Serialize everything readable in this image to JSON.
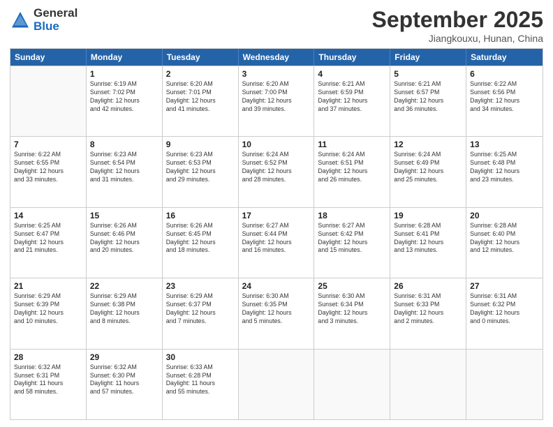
{
  "logo": {
    "general": "General",
    "blue": "Blue"
  },
  "header": {
    "month": "September 2025",
    "location": "Jiangkouxu, Hunan, China"
  },
  "days_of_week": [
    "Sunday",
    "Monday",
    "Tuesday",
    "Wednesday",
    "Thursday",
    "Friday",
    "Saturday"
  ],
  "weeks": [
    [
      {
        "day": "",
        "info": ""
      },
      {
        "day": "1",
        "info": "Sunrise: 6:19 AM\nSunset: 7:02 PM\nDaylight: 12 hours\nand 42 minutes."
      },
      {
        "day": "2",
        "info": "Sunrise: 6:20 AM\nSunset: 7:01 PM\nDaylight: 12 hours\nand 41 minutes."
      },
      {
        "day": "3",
        "info": "Sunrise: 6:20 AM\nSunset: 7:00 PM\nDaylight: 12 hours\nand 39 minutes."
      },
      {
        "day": "4",
        "info": "Sunrise: 6:21 AM\nSunset: 6:59 PM\nDaylight: 12 hours\nand 37 minutes."
      },
      {
        "day": "5",
        "info": "Sunrise: 6:21 AM\nSunset: 6:57 PM\nDaylight: 12 hours\nand 36 minutes."
      },
      {
        "day": "6",
        "info": "Sunrise: 6:22 AM\nSunset: 6:56 PM\nDaylight: 12 hours\nand 34 minutes."
      }
    ],
    [
      {
        "day": "7",
        "info": "Sunrise: 6:22 AM\nSunset: 6:55 PM\nDaylight: 12 hours\nand 33 minutes."
      },
      {
        "day": "8",
        "info": "Sunrise: 6:23 AM\nSunset: 6:54 PM\nDaylight: 12 hours\nand 31 minutes."
      },
      {
        "day": "9",
        "info": "Sunrise: 6:23 AM\nSunset: 6:53 PM\nDaylight: 12 hours\nand 29 minutes."
      },
      {
        "day": "10",
        "info": "Sunrise: 6:24 AM\nSunset: 6:52 PM\nDaylight: 12 hours\nand 28 minutes."
      },
      {
        "day": "11",
        "info": "Sunrise: 6:24 AM\nSunset: 6:51 PM\nDaylight: 12 hours\nand 26 minutes."
      },
      {
        "day": "12",
        "info": "Sunrise: 6:24 AM\nSunset: 6:49 PM\nDaylight: 12 hours\nand 25 minutes."
      },
      {
        "day": "13",
        "info": "Sunrise: 6:25 AM\nSunset: 6:48 PM\nDaylight: 12 hours\nand 23 minutes."
      }
    ],
    [
      {
        "day": "14",
        "info": "Sunrise: 6:25 AM\nSunset: 6:47 PM\nDaylight: 12 hours\nand 21 minutes."
      },
      {
        "day": "15",
        "info": "Sunrise: 6:26 AM\nSunset: 6:46 PM\nDaylight: 12 hours\nand 20 minutes."
      },
      {
        "day": "16",
        "info": "Sunrise: 6:26 AM\nSunset: 6:45 PM\nDaylight: 12 hours\nand 18 minutes."
      },
      {
        "day": "17",
        "info": "Sunrise: 6:27 AM\nSunset: 6:44 PM\nDaylight: 12 hours\nand 16 minutes."
      },
      {
        "day": "18",
        "info": "Sunrise: 6:27 AM\nSunset: 6:42 PM\nDaylight: 12 hours\nand 15 minutes."
      },
      {
        "day": "19",
        "info": "Sunrise: 6:28 AM\nSunset: 6:41 PM\nDaylight: 12 hours\nand 13 minutes."
      },
      {
        "day": "20",
        "info": "Sunrise: 6:28 AM\nSunset: 6:40 PM\nDaylight: 12 hours\nand 12 minutes."
      }
    ],
    [
      {
        "day": "21",
        "info": "Sunrise: 6:29 AM\nSunset: 6:39 PM\nDaylight: 12 hours\nand 10 minutes."
      },
      {
        "day": "22",
        "info": "Sunrise: 6:29 AM\nSunset: 6:38 PM\nDaylight: 12 hours\nand 8 minutes."
      },
      {
        "day": "23",
        "info": "Sunrise: 6:29 AM\nSunset: 6:37 PM\nDaylight: 12 hours\nand 7 minutes."
      },
      {
        "day": "24",
        "info": "Sunrise: 6:30 AM\nSunset: 6:35 PM\nDaylight: 12 hours\nand 5 minutes."
      },
      {
        "day": "25",
        "info": "Sunrise: 6:30 AM\nSunset: 6:34 PM\nDaylight: 12 hours\nand 3 minutes."
      },
      {
        "day": "26",
        "info": "Sunrise: 6:31 AM\nSunset: 6:33 PM\nDaylight: 12 hours\nand 2 minutes."
      },
      {
        "day": "27",
        "info": "Sunrise: 6:31 AM\nSunset: 6:32 PM\nDaylight: 12 hours\nand 0 minutes."
      }
    ],
    [
      {
        "day": "28",
        "info": "Sunrise: 6:32 AM\nSunset: 6:31 PM\nDaylight: 11 hours\nand 58 minutes."
      },
      {
        "day": "29",
        "info": "Sunrise: 6:32 AM\nSunset: 6:30 PM\nDaylight: 11 hours\nand 57 minutes."
      },
      {
        "day": "30",
        "info": "Sunrise: 6:33 AM\nSunset: 6:28 PM\nDaylight: 11 hours\nand 55 minutes."
      },
      {
        "day": "",
        "info": ""
      },
      {
        "day": "",
        "info": ""
      },
      {
        "day": "",
        "info": ""
      },
      {
        "day": "",
        "info": ""
      }
    ]
  ]
}
